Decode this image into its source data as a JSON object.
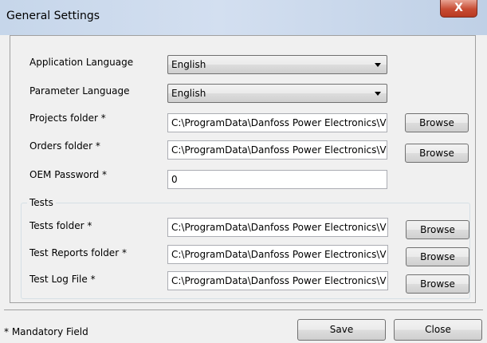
{
  "window": {
    "title": "General Settings",
    "close_glyph": "X"
  },
  "settings": {
    "app_language": {
      "label": "Application Language",
      "value": "English"
    },
    "param_language": {
      "label": "Parameter Language",
      "value": "English"
    },
    "projects_folder": {
      "label": "Projects folder *",
      "value": "C:\\ProgramData\\Danfoss Power Electronics\\V",
      "browse": "Browse"
    },
    "orders_folder": {
      "label": "Orders folder *",
      "value": "C:\\ProgramData\\Danfoss Power Electronics\\V",
      "browse": "Browse"
    },
    "oem_password": {
      "label": "OEM Password *",
      "value": "0"
    }
  },
  "tests": {
    "group_title": "Tests",
    "tests_folder": {
      "label": "Tests folder *",
      "value": "C:\\ProgramData\\Danfoss Power Electronics\\V",
      "browse": "Browse"
    },
    "test_reports_folder": {
      "label": "Test Reports folder *",
      "value": "C:\\ProgramData\\Danfoss Power Electronics\\V",
      "browse": "Browse"
    },
    "test_log_file": {
      "label": "Test Log File *",
      "value": "C:\\ProgramData\\Danfoss Power Electronics\\V",
      "browse": "Browse"
    }
  },
  "footer": {
    "mandatory_note": "* Mandatory Field",
    "save": "Save",
    "close": "Close"
  }
}
